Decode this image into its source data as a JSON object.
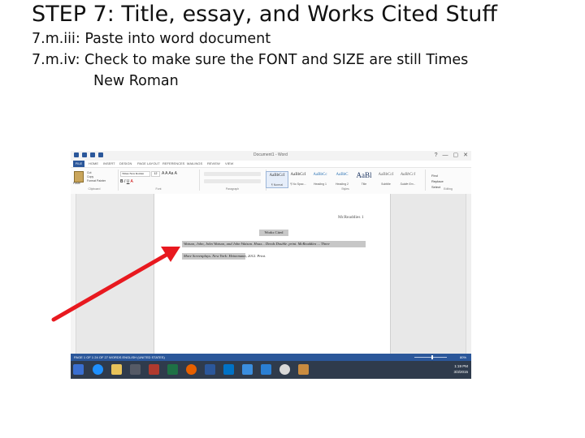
{
  "slide": {
    "title": "STEP 7: Title, essay, and Works Cited Stuff",
    "bullets": [
      "7.m.iii: Paste into word document",
      "7.m.iv: Check to make sure the FONT and SIZE are still Times",
      "New Roman"
    ]
  },
  "word": {
    "doc_title": "Document1 - Word",
    "window_controls": [
      "?",
      "—",
      "▢",
      "✕"
    ],
    "tabs": [
      "FILE",
      "HOME",
      "INSERT",
      "DESIGN",
      "PAGE LAYOUT",
      "REFERENCES",
      "MAILINGS",
      "REVIEW",
      "VIEW"
    ],
    "ribbon": {
      "paste_label": "Paste",
      "clipboard_items": [
        "Cut",
        "Copy",
        "Format Painter"
      ],
      "group_labels": [
        "Clipboard",
        "Font",
        "Paragraph",
        "Styles",
        "Editing"
      ],
      "font_name": "Times New Roman",
      "font_size": "12",
      "styles": [
        {
          "preview": "AaBbCcI",
          "name": "¶ Normal"
        },
        {
          "preview": "AaBbCcI",
          "name": "¶ No Spac..."
        },
        {
          "preview": "AaBbCc",
          "name": "Heading 1"
        },
        {
          "preview": "AaBbC",
          "name": "Heading 2"
        },
        {
          "preview": "AaBl",
          "name": "Title"
        },
        {
          "preview": "AaBbCcI",
          "name": "Subtitle"
        },
        {
          "preview": "AaBbCcI",
          "name": "Subtle Em..."
        }
      ],
      "editing": [
        "Find",
        "Replace",
        "Select"
      ]
    },
    "page": {
      "header": "McReaddies 1",
      "heading": "Works Cited",
      "citation_line1": "Watson, John, John Watson, and John Watson. Hoax... Deeds Double. print. McReaddies ... Three",
      "citation_line2": "More Screenplays. New York: Heinemann, 2012. Print."
    },
    "status": {
      "left": "PAGE 1 OF 1    24 OF 27 WORDS    ENGLISH (UNITED STATES)",
      "zoom": "80%",
      "zoom_level": 0.55
    },
    "taskbar": {
      "icons": [
        "windows-icon",
        "ie-icon",
        "explorer-icon",
        "app-icon",
        "excel-icon",
        "powerpoint-icon",
        "firefox-icon",
        "outlook-icon",
        "word-icon",
        "media-icon",
        "store-icon",
        "chrome-icon",
        "paint-icon"
      ],
      "clock_time": "1:19 PM",
      "clock_date": "3/3/2015"
    },
    "colors": {
      "accent": "#2b579a",
      "arrow": "#e8191f",
      "highlight": "#c7c7c7"
    }
  }
}
